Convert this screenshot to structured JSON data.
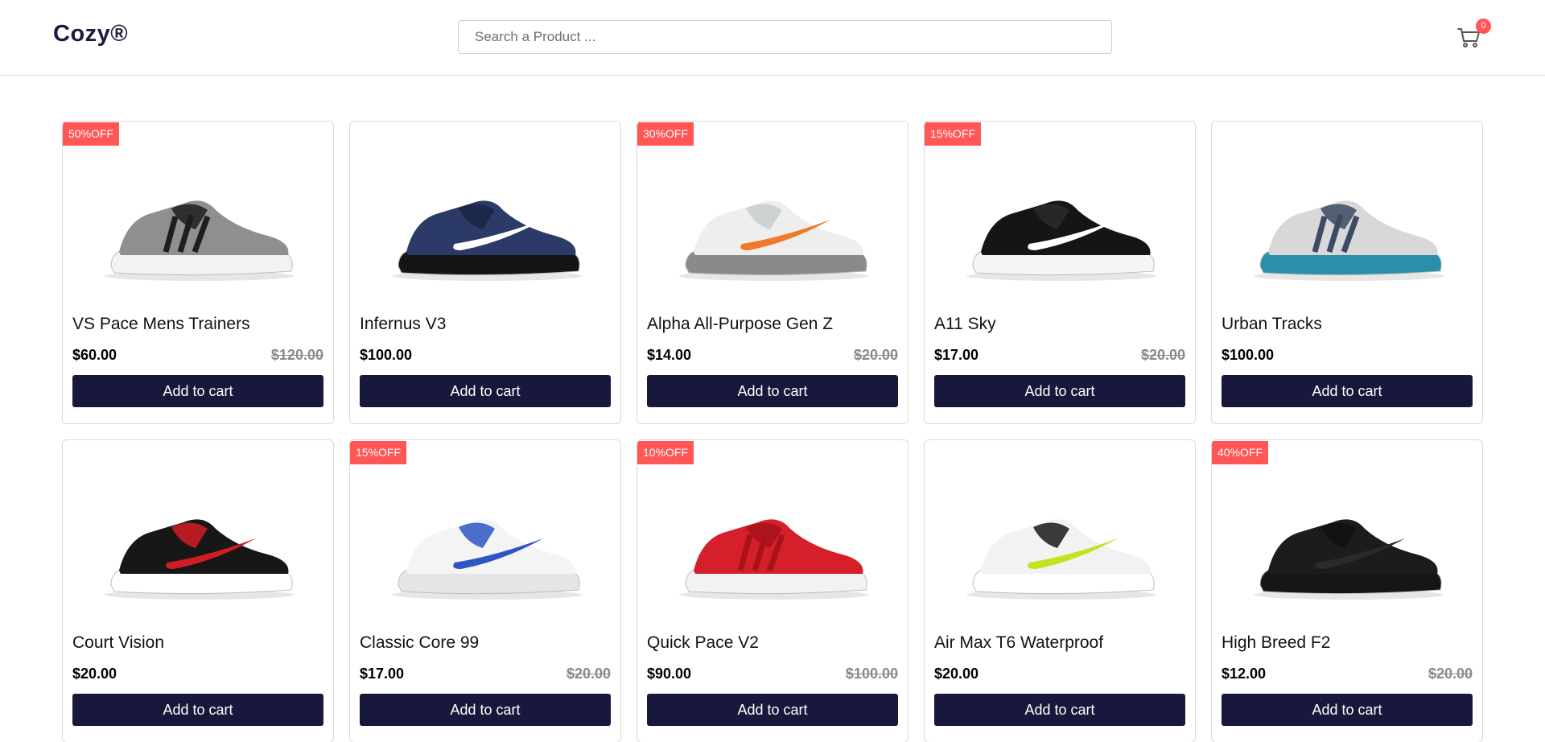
{
  "header": {
    "logo": "Cozy®",
    "search_placeholder": "Search a Product ...",
    "cart_count": "0"
  },
  "products": [
    {
      "name": "VS Pace Mens Trainers",
      "price": "$60.00",
      "old_price": "$120.00",
      "discount": "50%OFF",
      "shoe": "adidas-grey"
    },
    {
      "name": "Infernus V3",
      "price": "$100.00",
      "old_price": "",
      "discount": "",
      "shoe": "nike-navy"
    },
    {
      "name": "Alpha All-Purpose Gen Z",
      "price": "$14.00",
      "old_price": "$20.00",
      "discount": "30%OFF",
      "shoe": "nike-white-orange"
    },
    {
      "name": "A11 Sky",
      "price": "$17.00",
      "old_price": "$20.00",
      "discount": "15%OFF",
      "shoe": "nike-black"
    },
    {
      "name": "Urban Tracks",
      "price": "$100.00",
      "old_price": "",
      "discount": "",
      "shoe": "ua-grey-teal"
    },
    {
      "name": "Court Vision",
      "price": "$20.00",
      "old_price": "",
      "discount": "",
      "shoe": "nike-black-red"
    },
    {
      "name": "Classic Core 99",
      "price": "$17.00",
      "old_price": "$20.00",
      "discount": "15%OFF",
      "shoe": "reebok-white-blue"
    },
    {
      "name": "Quick Pace V2",
      "price": "$90.00",
      "old_price": "$100.00",
      "discount": "10%OFF",
      "shoe": "ua-red"
    },
    {
      "name": "Air Max T6 Waterproof",
      "price": "$20.00",
      "old_price": "",
      "discount": "",
      "shoe": "nike-white-volt"
    },
    {
      "name": "High Breed F2",
      "price": "$12.00",
      "old_price": "$20.00",
      "discount": "40%OFF",
      "shoe": "nike-all-black"
    }
  ],
  "button_label": "Add to cart",
  "colors": {
    "accent": "#18183c",
    "badge": "#ff5656",
    "logo": "#1a1a3e"
  },
  "shoe_colors": {
    "adidas-grey": {
      "upper": "#8f8f8f",
      "accent": "#1e1e1e",
      "sole": "#f2f2f2",
      "swoosh": ""
    },
    "nike-navy": {
      "upper": "#2b3a66",
      "accent": "#1b2444",
      "sole": "#151515",
      "swoosh": "#ffffff"
    },
    "nike-white-orange": {
      "upper": "#eeeeee",
      "accent": "#c9cccc",
      "sole": "#8a8a8a",
      "swoosh": "#f07a28"
    },
    "nike-black": {
      "upper": "#151515",
      "accent": "#2a2a2a",
      "sole": "#f5f5f5",
      "swoosh": "#ffffff"
    },
    "ua-grey-teal": {
      "upper": "#d8d8d8",
      "accent": "#3c4a63",
      "sole": "#2a8fa8",
      "swoosh": ""
    },
    "nike-black-red": {
      "upper": "#171717",
      "accent": "#d01c25",
      "sole": "#ffffff",
      "swoosh": "#d01c25"
    },
    "reebok-white-blue": {
      "upper": "#f4f4f4",
      "accent": "#2d56c4",
      "sole": "#e5e5e5",
      "swoosh": "#2d56c4"
    },
    "ua-red": {
      "upper": "#d51f2a",
      "accent": "#a8121b",
      "sole": "#f2f2f2",
      "swoosh": ""
    },
    "nike-white-volt": {
      "upper": "#f2f2f2",
      "accent": "#1a1a1a",
      "sole": "#ffffff",
      "swoosh": "#c6e11d"
    },
    "nike-all-black": {
      "upper": "#1c1c1c",
      "accent": "#111111",
      "sole": "#161616",
      "swoosh": "#2a2a2a"
    }
  }
}
